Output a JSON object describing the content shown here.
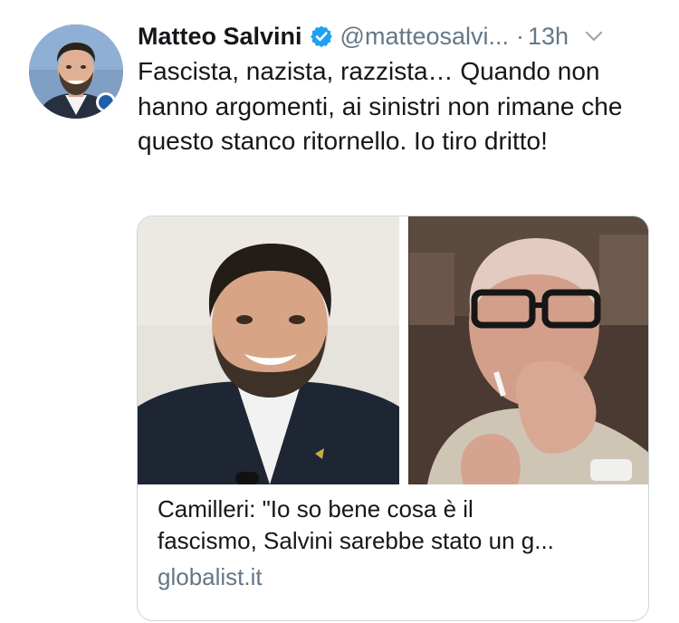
{
  "tweet": {
    "author": {
      "name": "Matteo Salvini",
      "handle": "@matteosalvi...",
      "verified": true
    },
    "separator": "·",
    "time": "13h",
    "text": "Fascista, nazista, razzista… Quando non hanno argomenti, ai sinistri non rimane che questo stanco ritornello. Io tiro dritto!",
    "card": {
      "title": "Camilleri: \"Io so bene cosa è il\nfascismo, Salvini sarebbe stato un g...",
      "domain": "globalist.it"
    }
  },
  "colors": {
    "verified_blue": "#1da1f2",
    "secondary_text": "#657786",
    "primary_text": "#14171a",
    "card_border": "#ccd6dd"
  },
  "icons": {
    "verified": "verified-badge-icon",
    "caret": "chevron-down-icon"
  }
}
